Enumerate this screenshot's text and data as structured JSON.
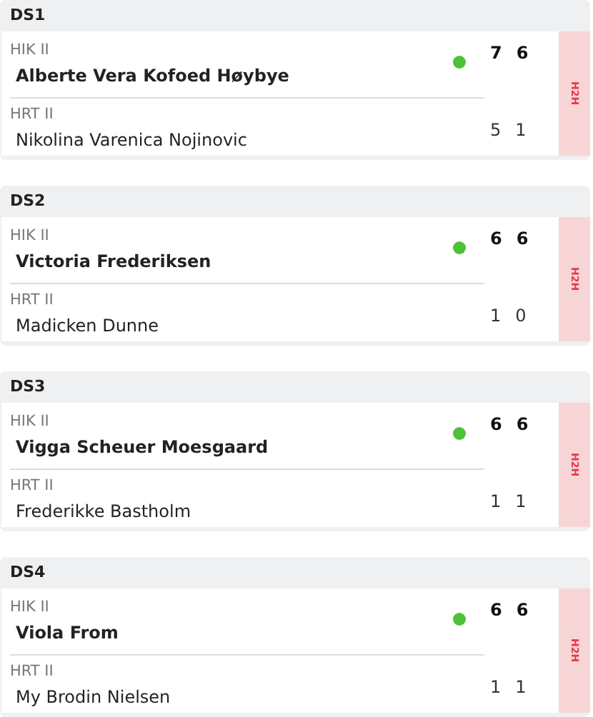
{
  "matches": [
    {
      "title": "DS1",
      "h2h": "H2H",
      "players": [
        {
          "team": "HIK II",
          "name": "Alberte Vera Kofoed Høybye",
          "winner": true,
          "scores": [
            "7",
            "6"
          ]
        },
        {
          "team": "HRT II",
          "name": "Nikolina Varenica Nojinovic",
          "winner": false,
          "scores": [
            "5",
            "1"
          ]
        }
      ]
    },
    {
      "title": "DS2",
      "h2h": "H2H",
      "players": [
        {
          "team": "HIK II",
          "name": "Victoria Frederiksen",
          "winner": true,
          "scores": [
            "6",
            "6"
          ]
        },
        {
          "team": "HRT II",
          "name": "Madicken Dunne",
          "winner": false,
          "scores": [
            "1",
            "0"
          ]
        }
      ]
    },
    {
      "title": "DS3",
      "h2h": "H2H",
      "players": [
        {
          "team": "HIK II",
          "name": "Vigga Scheuer Moesgaard",
          "winner": true,
          "scores": [
            "6",
            "6"
          ]
        },
        {
          "team": "HRT II",
          "name": "Frederikke Bastholm",
          "winner": false,
          "scores": [
            "1",
            "1"
          ]
        }
      ]
    },
    {
      "title": "DS4",
      "h2h": "H2H",
      "players": [
        {
          "team": "HIK II",
          "name": "Viola From",
          "winner": true,
          "scores": [
            "6",
            "6"
          ]
        },
        {
          "team": "HRT II",
          "name": "My Brodin Nielsen",
          "winner": false,
          "scores": [
            "1",
            "1"
          ]
        }
      ]
    }
  ]
}
